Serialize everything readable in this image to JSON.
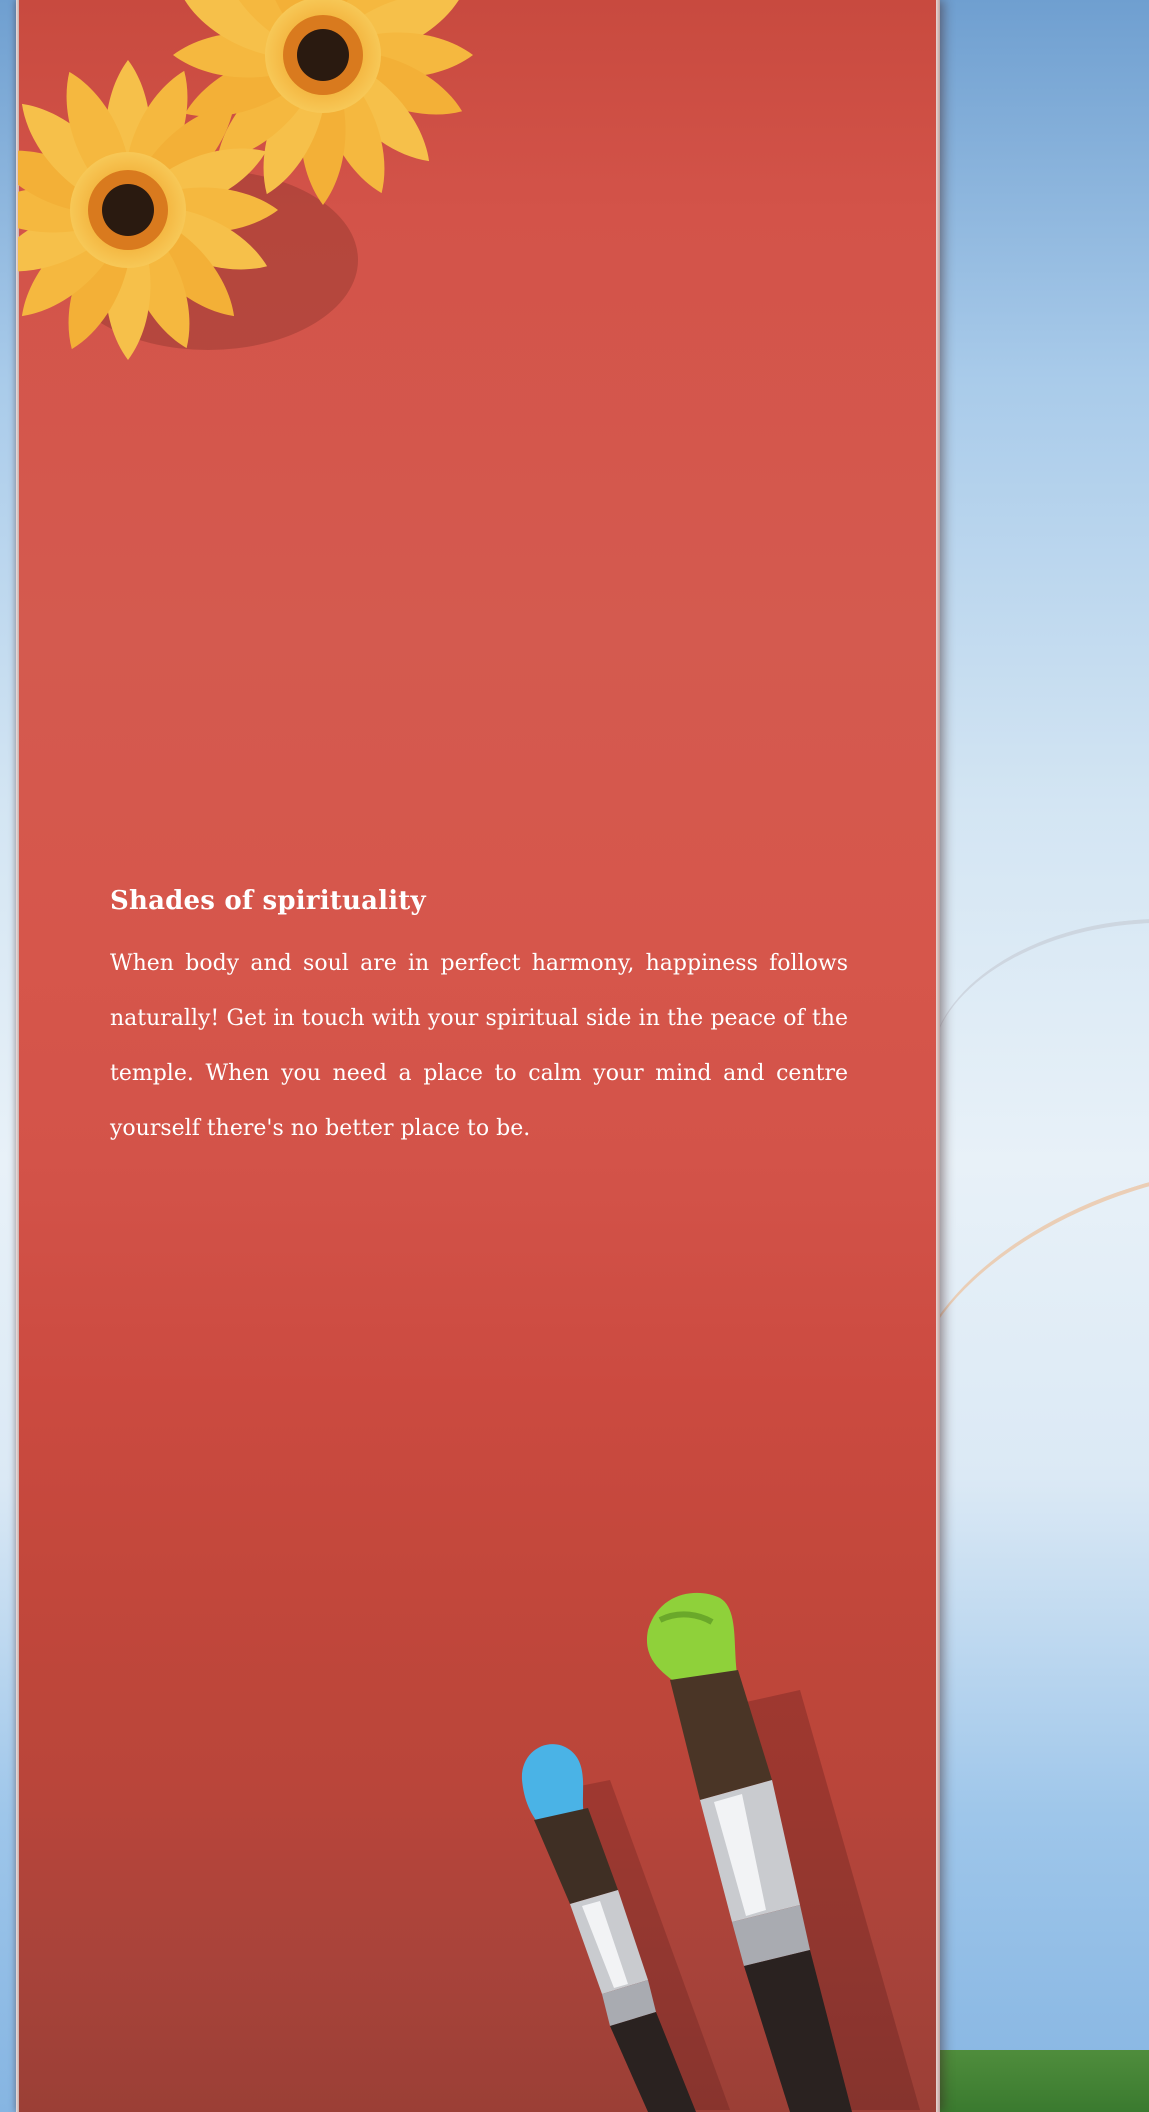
{
  "article": {
    "heading": "Shades of spirituality",
    "body": "When body and soul are in perfect harmony, happiness follows naturally! Get in touch with your spiritual side in the peace of the temple. When you need a place to calm your mind and centre yourself there's no better place to be."
  },
  "colors": {
    "panel": "#d35349",
    "sky": "#a9cbea",
    "flower_petal": "#f4b43a",
    "flower_center": "#2a1a10",
    "brush_green": "#8fd13a",
    "brush_blue": "#4ab3e6"
  }
}
